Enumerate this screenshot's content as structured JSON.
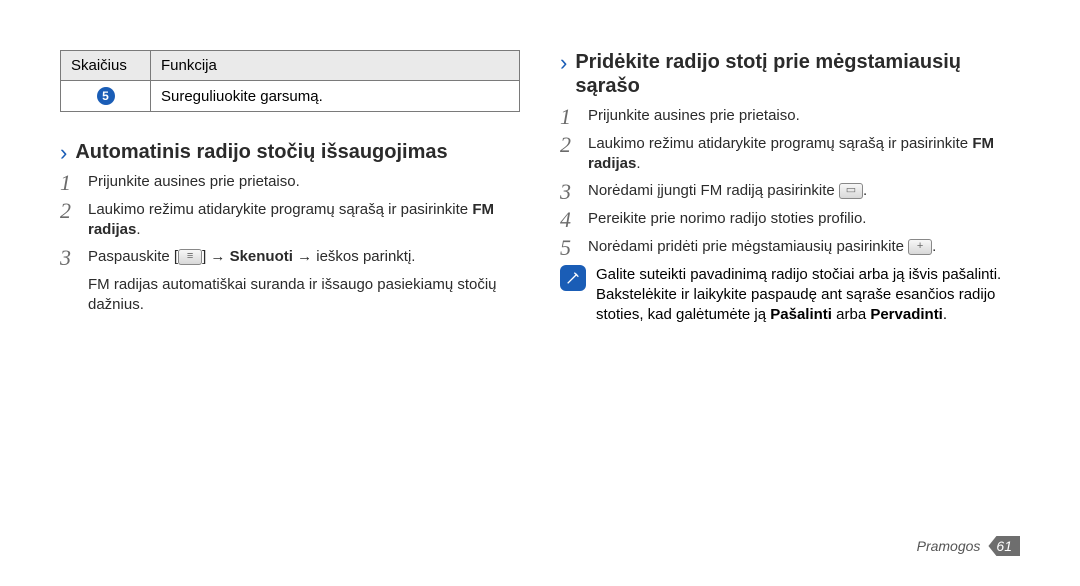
{
  "table": {
    "headers": [
      "Skaičius",
      "Funkcija"
    ],
    "row": {
      "num": "5",
      "text": "Sureguliuokite garsumą."
    }
  },
  "left": {
    "title": "Automatinis radijo stočių išsaugojimas",
    "step1": "Prijunkite ausines prie prietaiso.",
    "step2_a": "Laukimo režimu atidarykite programų sąrašą ir pasirinkite ",
    "step2_b": "FM radijas",
    "step2_c": ".",
    "step3_a": "Paspauskite [",
    "step3_b": "] → ",
    "step3_c": "Skenuoti",
    "step3_d": " → ieškos parinktį.",
    "menu_icon": "≡",
    "step3_sub": "FM radijas automatiškai suranda ir išsaugo pasiekiamų stočių dažnius."
  },
  "right": {
    "title": "Pridėkite radijo stotį prie mėgstamiausių sąrašo",
    "step1": "Prijunkite ausines prie prietaiso.",
    "step2_a": "Laukimo režimu atidarykite programų sąrašą ir pasirinkite ",
    "step2_b": "FM radijas",
    "step2_c": ".",
    "step3_a": "Norėdami įjungti FM radiją pasirinkite ",
    "step3_b": ".",
    "play_icon": "▭",
    "step4": "Pereikite prie norimo radijo stoties profilio.",
    "step5_a": "Norėdami pridėti prie mėgstamiausių pasirinkite ",
    "step5_b": ".",
    "plus_icon": "+",
    "note_a": "Galite suteikti pavadinimą radijo stočiai arba ją išvis pašalinti. Bakstelėkite ir laikykite paspaudę ant sąraše esančios radijo stoties, kad galėtumėte ją ",
    "note_b": "Pašalinti",
    "note_c": " arba ",
    "note_d": "Pervadinti",
    "note_e": "."
  },
  "footer": {
    "section": "Pramogos",
    "page": "61"
  }
}
